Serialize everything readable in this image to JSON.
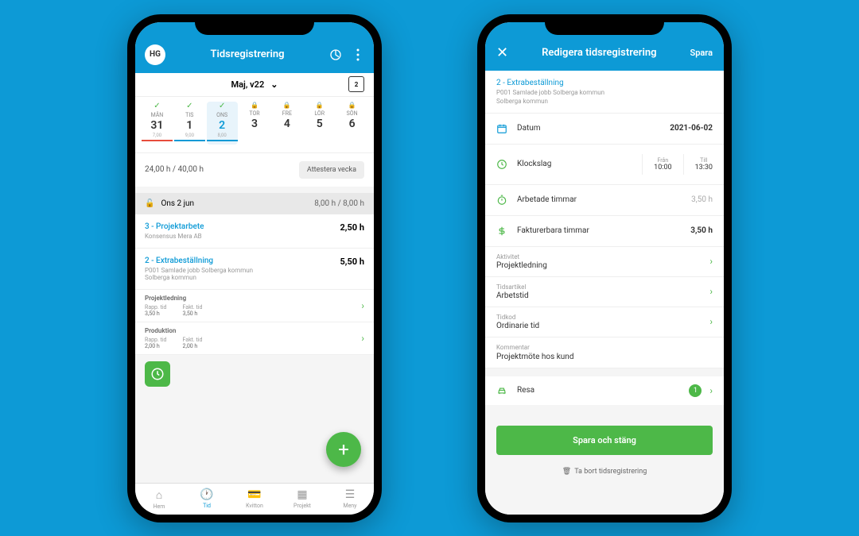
{
  "left": {
    "avatar": "HG",
    "title": "Tidsregistrering",
    "week_label": "Maj, v22",
    "days": [
      {
        "name": "MÅN",
        "num": "31",
        "sub": "7,00",
        "status": "check",
        "bar": "red"
      },
      {
        "name": "TIS",
        "num": "1",
        "sub": "9,00",
        "status": "check",
        "bar": "blue"
      },
      {
        "name": "ONS",
        "num": "2",
        "sub": "8,00",
        "status": "check",
        "bar": "blue",
        "active": true
      },
      {
        "name": "TOR",
        "num": "3",
        "sub": "",
        "status": "lock"
      },
      {
        "name": "FRE",
        "num": "4",
        "sub": "",
        "status": "lock"
      },
      {
        "name": "LÖR",
        "num": "5",
        "sub": "",
        "status": "lock"
      },
      {
        "name": "SÖN",
        "num": "6",
        "sub": "",
        "status": "lock"
      }
    ],
    "summary": "24,00 h / 40,00 h",
    "attest_btn": "Attestera vecka",
    "day_header": {
      "label": "Ons 2 jun",
      "hours": "8,00 h / 8,00 h"
    },
    "entries": [
      {
        "title": "3 - Projektarbete",
        "sub": "Konsensus Mera AB",
        "hours": "2,50 h"
      },
      {
        "title": "2 - Extrabeställning",
        "sub": "P001 Samlade jobb Solberga kommun\nSolberga kommun",
        "hours": "5,50 h"
      }
    ],
    "tasks": [
      {
        "name": "Projektledning",
        "rapp_label": "Rapp. tid",
        "rapp": "3,50 h",
        "fakt_label": "Fakt. tid",
        "fakt": "3,50 h"
      },
      {
        "name": "Produktion",
        "rapp_label": "Rapp. tid",
        "rapp": "2,00 h",
        "fakt_label": "Fakt. tid",
        "fakt": "2,00 h"
      }
    ],
    "tabs": [
      {
        "label": "Hem"
      },
      {
        "label": "Tid",
        "active": true
      },
      {
        "label": "Kvitton"
      },
      {
        "label": "Projekt"
      },
      {
        "label": "Meny"
      }
    ]
  },
  "right": {
    "title": "Redigera tidsregistrering",
    "save": "Spara",
    "project": {
      "title": "2 - Extrabeställning",
      "line1": "P001 Samlade jobb Solberga kommun",
      "line2": "Solberga kommun"
    },
    "date": {
      "label": "Datum",
      "value": "2021-06-02"
    },
    "clock": {
      "label": "Klockslag",
      "from_label": "Från",
      "from": "10:00",
      "to_label": "Till",
      "to": "13:30"
    },
    "worked": {
      "label": "Arbetade timmar",
      "value": "3,50 h"
    },
    "billable": {
      "label": "Fakturerbara timmar",
      "value": "3,50 h"
    },
    "activity": {
      "label": "Aktivitet",
      "value": "Projektledning"
    },
    "article": {
      "label": "Tidsartikel",
      "value": "Arbetstid"
    },
    "code": {
      "label": "Tidkod",
      "value": "Ordinarie tid"
    },
    "comment": {
      "label": "Kommentar",
      "value": "Projektmöte hos kund"
    },
    "travel": {
      "label": "Resa",
      "count": "1"
    },
    "save_close": "Spara och stäng",
    "delete": "Ta bort tidsregistrering"
  }
}
